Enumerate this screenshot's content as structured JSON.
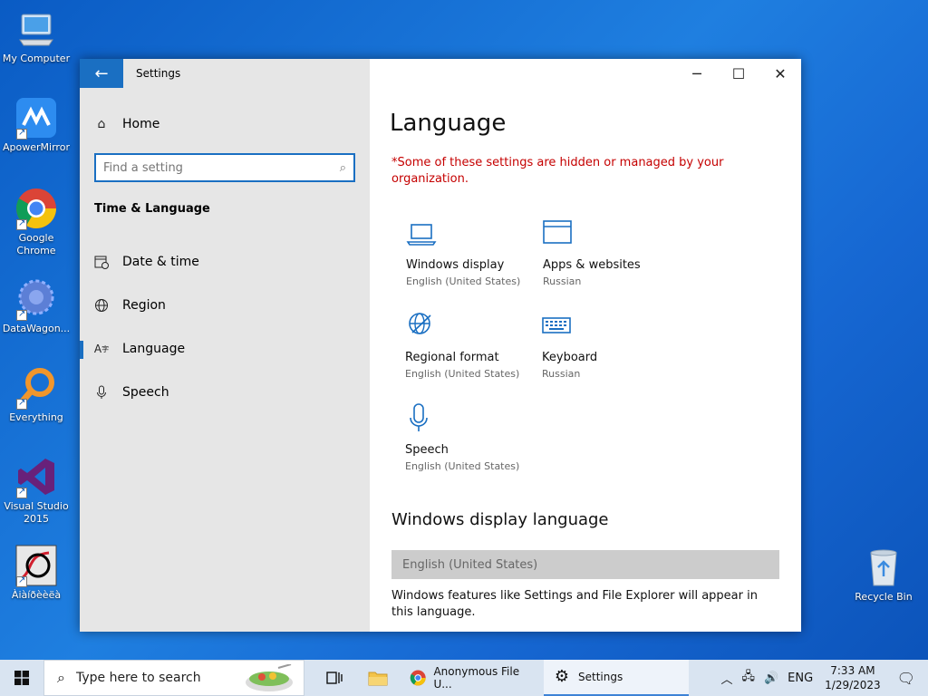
{
  "desktop": {
    "icons": [
      {
        "label": "My Computer"
      },
      {
        "label": "ApowerMirror"
      },
      {
        "label": "Google Chrome"
      },
      {
        "label": "DataWagon..."
      },
      {
        "label": "Everything"
      },
      {
        "label": "Visual Studio 2015"
      },
      {
        "label": "Àiàíðèèëà"
      },
      {
        "label": "Recycle Bin"
      }
    ]
  },
  "window": {
    "title": "Settings",
    "back_icon": "back-arrow-icon",
    "controls": {
      "minimize": "─",
      "maximize": "☐",
      "close": "✕"
    }
  },
  "sidebar": {
    "home_label": "Home",
    "search_placeholder": "Find a setting",
    "section_title": "Time & Language",
    "items": [
      {
        "label": "Date & time",
        "icon": "calendar-clock-icon"
      },
      {
        "label": "Region",
        "icon": "globe-icon"
      },
      {
        "label": "Language",
        "icon": "language-icon",
        "active": true
      },
      {
        "label": "Speech",
        "icon": "microphone-icon"
      }
    ]
  },
  "main": {
    "title": "Language",
    "warning": "*Some of these settings are hidden or managed by your organization.",
    "tiles": [
      {
        "name": "Windows display",
        "sub": "English (United States)",
        "icon": "laptop-icon"
      },
      {
        "name": "Apps & websites",
        "sub": "Russian",
        "icon": "window-icon"
      },
      {
        "name": "Regional format",
        "sub": "English (United States)",
        "icon": "regional-globe-icon"
      },
      {
        "name": "Keyboard",
        "sub": "Russian",
        "icon": "keyboard-icon"
      },
      {
        "name": "Speech",
        "sub": "English (United States)",
        "icon": "microphone-icon"
      }
    ],
    "display_language_heading": "Windows display language",
    "display_language_value": "English (United States)",
    "display_language_desc": "Windows features like Settings and File Explorer will appear in this language."
  },
  "taskbar": {
    "search_placeholder": "Type here to search",
    "apps": [
      {
        "label": "Anonymous File U...",
        "icon": "chrome-icon"
      },
      {
        "label": "Settings",
        "icon": "gear-icon",
        "active": true
      }
    ],
    "tray": {
      "language": "ENG",
      "time": "7:33 AM",
      "date": "1/29/2023"
    }
  },
  "colors": {
    "accent": "#1a6fc2",
    "warning": "#c50000",
    "sidebar_bg": "#e6e6e6"
  }
}
